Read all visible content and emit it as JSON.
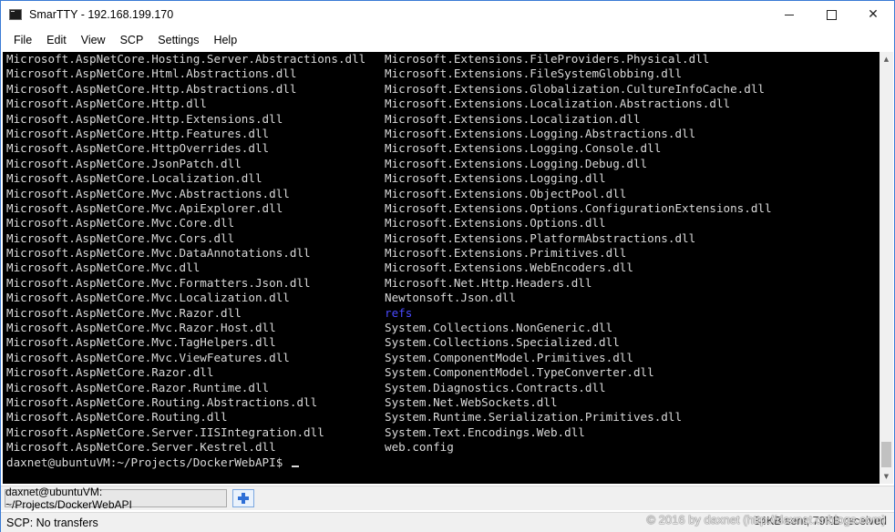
{
  "window": {
    "title": "SmarTTY - 192.168.199.170",
    "controls": {
      "minimize": "minimize",
      "maximize": "maximize",
      "close": "✕"
    }
  },
  "menu": [
    "File",
    "Edit",
    "View",
    "SCP",
    "Settings",
    "Help"
  ],
  "terminal": {
    "left_column": [
      "Microsoft.AspNetCore.Hosting.Server.Abstractions.dll",
      "Microsoft.AspNetCore.Html.Abstractions.dll",
      "Microsoft.AspNetCore.Http.Abstractions.dll",
      "Microsoft.AspNetCore.Http.dll",
      "Microsoft.AspNetCore.Http.Extensions.dll",
      "Microsoft.AspNetCore.Http.Features.dll",
      "Microsoft.AspNetCore.HttpOverrides.dll",
      "Microsoft.AspNetCore.JsonPatch.dll",
      "Microsoft.AspNetCore.Localization.dll",
      "Microsoft.AspNetCore.Mvc.Abstractions.dll",
      "Microsoft.AspNetCore.Mvc.ApiExplorer.dll",
      "Microsoft.AspNetCore.Mvc.Core.dll",
      "Microsoft.AspNetCore.Mvc.Cors.dll",
      "Microsoft.AspNetCore.Mvc.DataAnnotations.dll",
      "Microsoft.AspNetCore.Mvc.dll",
      "Microsoft.AspNetCore.Mvc.Formatters.Json.dll",
      "Microsoft.AspNetCore.Mvc.Localization.dll",
      "Microsoft.AspNetCore.Mvc.Razor.dll",
      "Microsoft.AspNetCore.Mvc.Razor.Host.dll",
      "Microsoft.AspNetCore.Mvc.TagHelpers.dll",
      "Microsoft.AspNetCore.Mvc.ViewFeatures.dll",
      "Microsoft.AspNetCore.Razor.dll",
      "Microsoft.AspNetCore.Razor.Runtime.dll",
      "Microsoft.AspNetCore.Routing.Abstractions.dll",
      "Microsoft.AspNetCore.Routing.dll",
      "Microsoft.AspNetCore.Server.IISIntegration.dll",
      "Microsoft.AspNetCore.Server.Kestrel.dll"
    ],
    "right_column": [
      "Microsoft.Extensions.FileProviders.Physical.dll",
      "Microsoft.Extensions.FileSystemGlobbing.dll",
      "Microsoft.Extensions.Globalization.CultureInfoCache.dll",
      "Microsoft.Extensions.Localization.Abstractions.dll",
      "Microsoft.Extensions.Localization.dll",
      "Microsoft.Extensions.Logging.Abstractions.dll",
      "Microsoft.Extensions.Logging.Console.dll",
      "Microsoft.Extensions.Logging.Debug.dll",
      "Microsoft.Extensions.Logging.dll",
      "Microsoft.Extensions.ObjectPool.dll",
      "Microsoft.Extensions.Options.ConfigurationExtensions.dll",
      "Microsoft.Extensions.Options.dll",
      "Microsoft.Extensions.PlatformAbstractions.dll",
      "Microsoft.Extensions.Primitives.dll",
      "Microsoft.Extensions.WebEncoders.dll",
      "Microsoft.Net.Http.Headers.dll",
      "Newtonsoft.Json.dll",
      "refs",
      "System.Collections.NonGeneric.dll",
      "System.Collections.Specialized.dll",
      "System.ComponentModel.Primitives.dll",
      "System.ComponentModel.TypeConverter.dll",
      "System.Diagnostics.Contracts.dll",
      "System.Net.WebSockets.dll",
      "System.Runtime.Serialization.Primitives.dll",
      "System.Text.Encodings.Web.dll",
      "web.config"
    ],
    "directory_entries": [
      "refs"
    ],
    "prompt": "daxnet@ubuntuVM:~/Projects/DockerWebAPI$ ",
    "colors": {
      "background": "#000000",
      "text": "#d9d9d9",
      "directory": "#4a4aff"
    }
  },
  "tabs": {
    "active_label": "daxnet@ubuntuVM: ~/Projects/DockerWebAPI",
    "add_icon": "plus-icon"
  },
  "status": {
    "scp": "SCP: No transfers",
    "transfer": "34KB sent, 79KB received",
    "watermark": "© 2016 by daxnet (http://daxnet.cnblogs.com)"
  }
}
